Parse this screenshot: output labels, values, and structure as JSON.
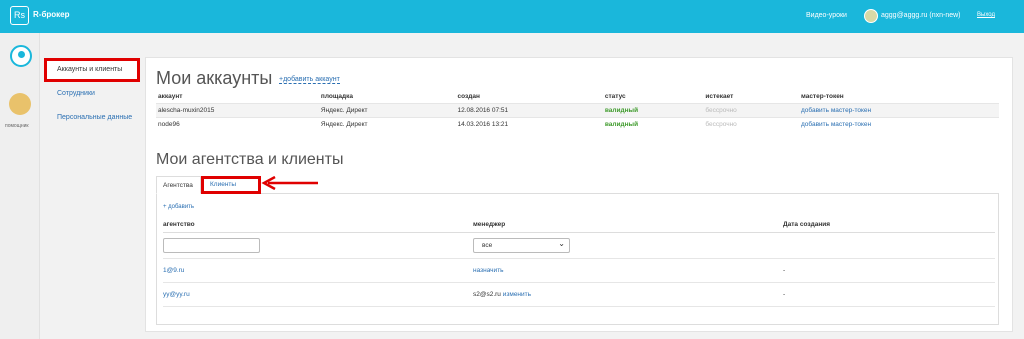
{
  "topbar": {
    "logo": "Rs",
    "brand": "R-брокер",
    "video": "Видео-уроки",
    "user": "aggg@aggg.ru (nxn-new)",
    "logout": "Выход"
  },
  "side": {
    "help": "помощник"
  },
  "nav": [
    "Аккаунты и клиенты",
    "Сотрудники",
    "Персональные данные"
  ],
  "accounts": {
    "title": "Мои аккаунты",
    "add": "+добавить аккаунт",
    "headers": [
      "аккаунт",
      "площадка",
      "создан",
      "статус",
      "истекает",
      "мастер-токен"
    ],
    "rows": [
      [
        "alescha-muxin2015",
        "Яндекс. Директ",
        "12.08.2016 07:51",
        "валидный",
        "бессрочно",
        "добавить мастер-токен"
      ],
      [
        "node96",
        "Яндекс. Директ",
        "14.03.2016 13:21",
        "валидный",
        "бессрочно",
        "добавить мастер-токен"
      ]
    ]
  },
  "agencies": {
    "title": "Мои агентства и клиенты",
    "tabs": [
      "Агентства",
      "Клиенты"
    ],
    "add": "+ добавить",
    "headers": [
      "агентство",
      "менеджер",
      "Дата создания"
    ],
    "filter_select": "все",
    "rows": [
      [
        "1@9.ru",
        "назначить",
        "",
        "-"
      ],
      [
        "yy@yy.ru",
        "s2@s2.ru",
        "изменить",
        "-"
      ]
    ]
  }
}
